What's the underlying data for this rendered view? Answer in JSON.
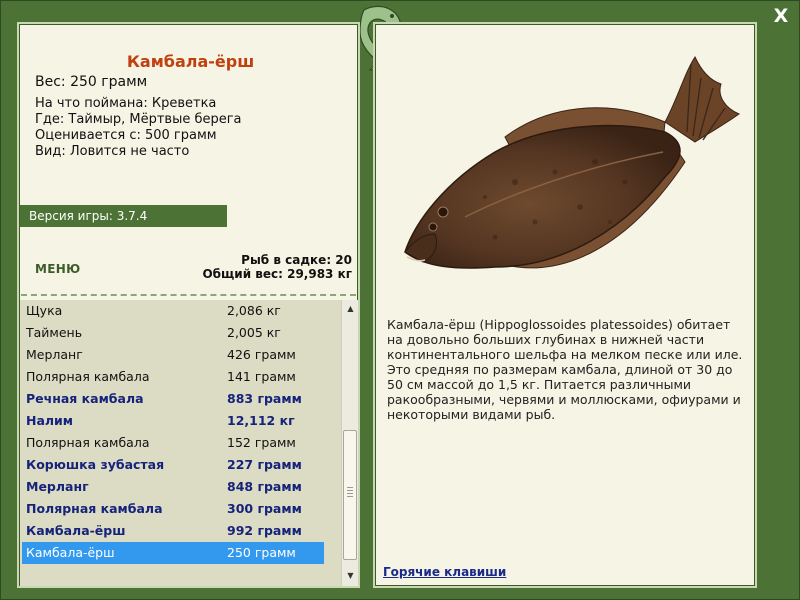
{
  "window": {
    "close_label": "X"
  },
  "fish": {
    "title": "Камбала-ёрш",
    "weight_line": "Вес: 250 грамм",
    "details": [
      "На что поймана: Креветка",
      "Где: Таймыр, Мёртвые берега",
      "Оценивается с: 500 грамм",
      "Вид: Ловится не часто"
    ],
    "description": "Камбала-ёрш (Hippoglossoides platessoides) обитает на довольно больших глубинах в нижней части континентального шельфа на мелком песке или иле. Это средняя по размерам камбала, длиной от 30 до 50 см массой до 1,5 кг. Питается различными ракообразными, червями и моллюсками, офиурами и некоторыми видами рыб."
  },
  "version": "Версия игры: 3.7.4",
  "menu_label": "МЕНЮ",
  "stats": {
    "in_cage": "Рыб в садке: 20",
    "total_weight": "Общий вес: 29,983 кг"
  },
  "catch_list": [
    {
      "name": "Щука",
      "weight": "2,086 кг",
      "bold": false,
      "selected": false
    },
    {
      "name": "Таймень",
      "weight": "2,005 кг",
      "bold": false,
      "selected": false
    },
    {
      "name": "Мерланг",
      "weight": "426 грамм",
      "bold": false,
      "selected": false
    },
    {
      "name": "Полярная камбала",
      "weight": "141 грамм",
      "bold": false,
      "selected": false
    },
    {
      "name": "Речная камбала",
      "weight": "883 грамм",
      "bold": true,
      "selected": false
    },
    {
      "name": "Налим",
      "weight": "12,112 кг",
      "bold": true,
      "selected": false
    },
    {
      "name": "Полярная камбала",
      "weight": "152 грамм",
      "bold": false,
      "selected": false
    },
    {
      "name": "Корюшка зубастая",
      "weight": "227 грамм",
      "bold": true,
      "selected": false
    },
    {
      "name": "Мерланг",
      "weight": "848 грамм",
      "bold": true,
      "selected": false
    },
    {
      "name": "Полярная камбала",
      "weight": "300 грамм",
      "bold": true,
      "selected": false
    },
    {
      "name": "Камбала-ёрш",
      "weight": "992 грамм",
      "bold": true,
      "selected": false
    },
    {
      "name": "Камбала-ёрш",
      "weight": "250 грамм",
      "bold": false,
      "selected": true
    }
  ],
  "hotkeys_label": "Горячие клавиши",
  "colors": {
    "frame": "#4d7236",
    "title": "#c0400f",
    "bold_item": "#16237a",
    "selection": "#3399ee",
    "fish_body": "#5a3a24"
  }
}
